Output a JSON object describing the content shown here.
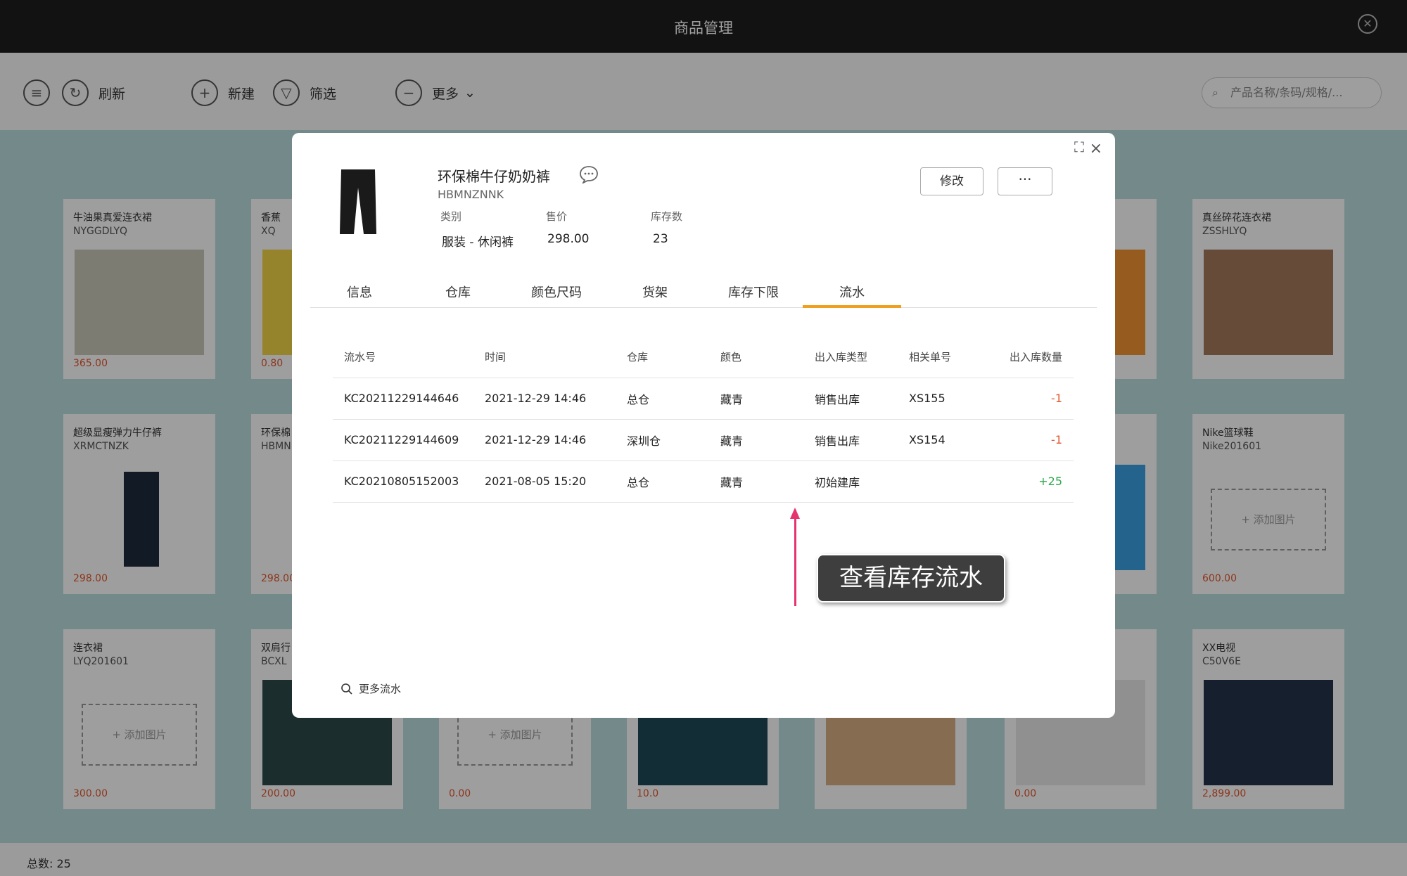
{
  "window": {
    "title": "商品管理"
  },
  "toolbar": {
    "refresh": "刷新",
    "new": "新建",
    "filter": "筛选",
    "more": "更多",
    "search_placeholder": "产品名称/条码/规格/..."
  },
  "cards": [
    {
      "name": "牛油果真爱连衣裙",
      "code": "NYGGDLYQ",
      "price": "365.00"
    },
    {
      "name": "香蕉",
      "code": "XQ",
      "price": "0.80"
    },
    {
      "name": "",
      "code": "",
      "price": ""
    },
    {
      "name": "",
      "code": "",
      "price": ""
    },
    {
      "name": "",
      "code": "",
      "price": ""
    },
    {
      "name": "",
      "code": "",
      "price": ""
    },
    {
      "name": "真丝碎花连衣裙",
      "code": "ZSSHLYQ",
      "price": ""
    },
    {
      "name": "超级显瘦弹力牛仔裤",
      "code": "XRMCTNZK",
      "price": "298.00"
    },
    {
      "name": "环保棉",
      "code": "HBMN",
      "price": "298.00"
    },
    {
      "name": "Nike篮球鞋",
      "code": "Nike201601",
      "price": "600.00",
      "add": "+ 添加图片"
    },
    {
      "name": "连衣裙",
      "code": "LYQ201601",
      "price": "300.00",
      "add": "+ 添加图片"
    },
    {
      "name": "双肩行",
      "code": "BCXL",
      "price": "200.00"
    },
    {
      "name": "",
      "code": "",
      "price": "0.00",
      "add": "+ 添加图片"
    },
    {
      "name": "",
      "code": "",
      "price": "10.0"
    },
    {
      "name": "",
      "code": "",
      "price": ""
    },
    {
      "name": "",
      "code": "",
      "price": "0.00"
    },
    {
      "name": "XX电视",
      "code": "C50V6E",
      "price": "2,899.00"
    }
  ],
  "footer": {
    "total": "总数: 25"
  },
  "product": {
    "name": "环保棉牛仔奶奶裤",
    "code": "HBMNZNNK",
    "category_label": "类别",
    "category": "服装 - 休闲裤",
    "price_label": "售价",
    "price": "298.00",
    "stock_label": "库存数",
    "stock": "23"
  },
  "buttons": {
    "edit": "修改",
    "more": "···"
  },
  "tabs": [
    "信息",
    "仓库",
    "颜色尺码",
    "货架",
    "库存下限",
    "流水"
  ],
  "flow_table": {
    "headers": [
      "流水号",
      "时间",
      "仓库",
      "颜色",
      "出入库类型",
      "相关单号",
      "出入库数量"
    ],
    "rows": [
      [
        "KC20211229144646",
        "2021-12-29 14:46",
        "总仓",
        "藏青",
        "销售出库",
        "XS155",
        "-1"
      ],
      [
        "KC20211229144609",
        "2021-12-29 14:46",
        "深圳仓",
        "藏青",
        "销售出库",
        "XS154",
        "-1"
      ],
      [
        "KC20210805152003",
        "2021-08-05 15:20",
        "总仓",
        "藏青",
        "初始建库",
        "",
        "+25"
      ]
    ]
  },
  "more_flow": "更多流水",
  "annotation": {
    "text": "查看库存流水",
    "color": "#e6336f"
  }
}
